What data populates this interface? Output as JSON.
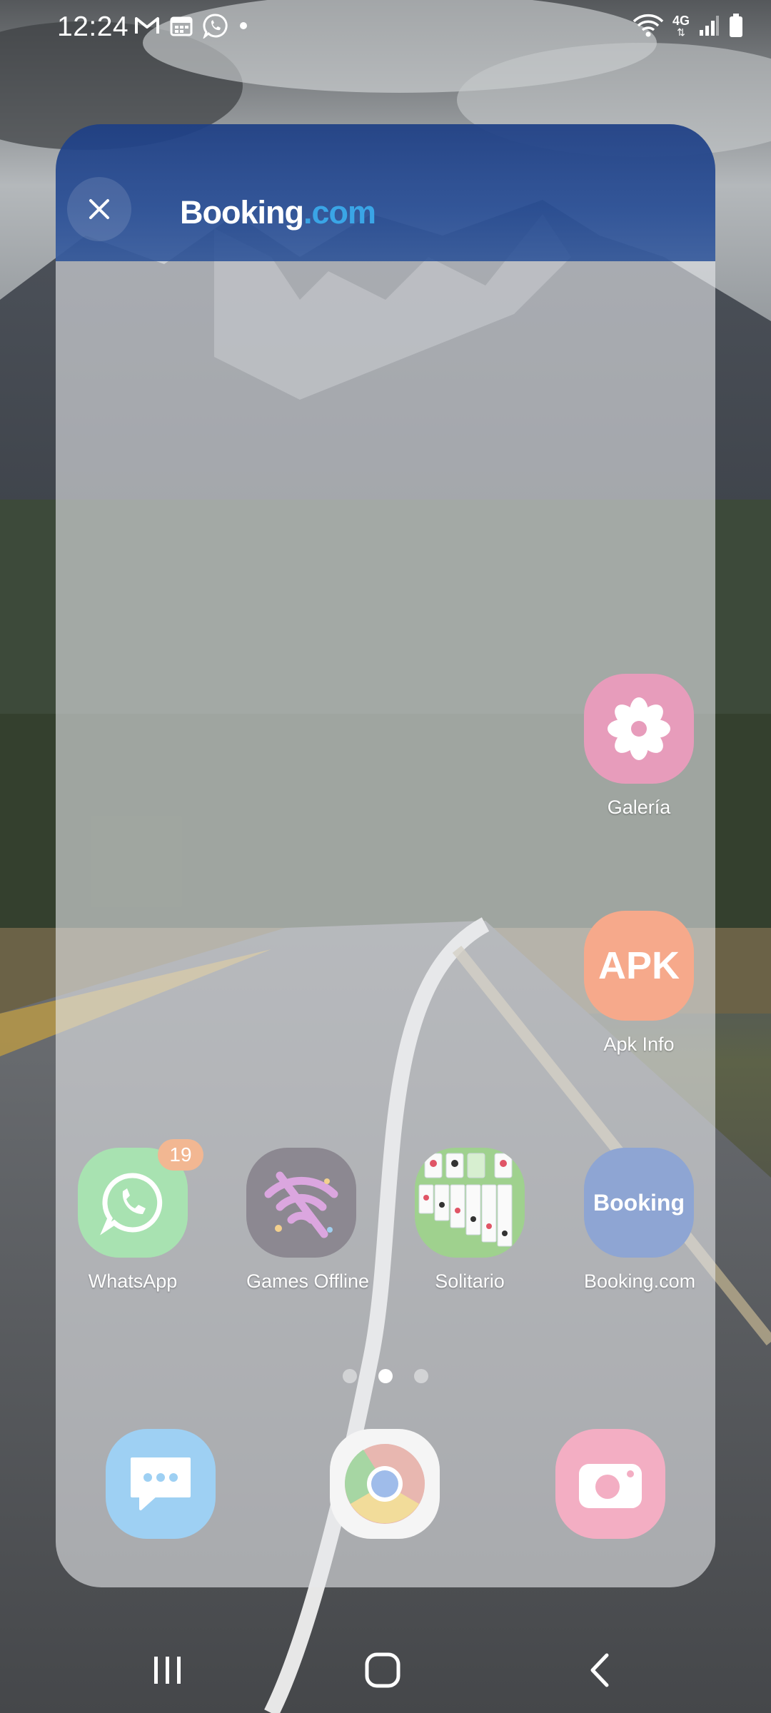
{
  "status_bar": {
    "time": "12:24",
    "notification_icons": [
      "gmail-icon",
      "calendar-icon",
      "whatsapp-icon",
      "dot-icon"
    ],
    "network": "4G",
    "system_icons": [
      "wifi-icon",
      "signal-icon",
      "battery-icon"
    ]
  },
  "recent_app": {
    "title_main": "Booking",
    "title_suffix": ".com",
    "header_color": "#1e3f85",
    "accent_color": "#3aa5e6"
  },
  "home_apps": [
    {
      "label": "Galería",
      "icon": "gallery-icon"
    },
    {
      "label": "Apk Info",
      "icon": "apk-icon",
      "icon_text": "APK"
    },
    {
      "label": "WhatsApp",
      "icon": "whatsapp-icon",
      "badge": "19"
    },
    {
      "label": "Games Offline",
      "icon": "games-offline-icon"
    },
    {
      "label": "Solitario",
      "icon": "solitaire-icon"
    },
    {
      "label": "Booking.com",
      "icon": "booking-icon",
      "icon_text": "Booking"
    }
  ],
  "page_indicator": {
    "pages": 3,
    "current": 2
  },
  "dock": [
    {
      "icon": "messages-icon"
    },
    {
      "icon": "chrome-icon"
    },
    {
      "icon": "camera-icon"
    }
  ],
  "nav_bar": [
    "recents-icon",
    "home-icon",
    "back-icon"
  ]
}
